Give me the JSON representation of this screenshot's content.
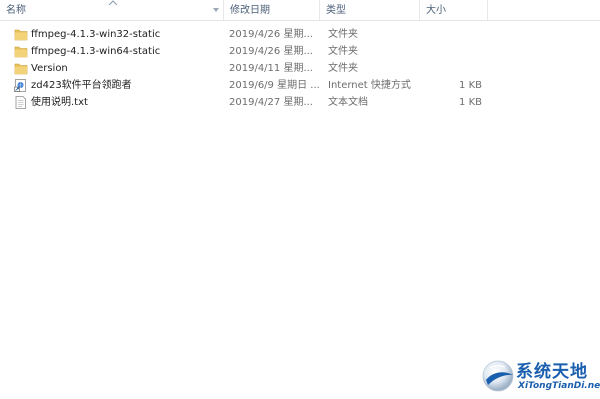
{
  "columns": {
    "name": "名称",
    "date": "修改日期",
    "type": "类型",
    "size": "大小"
  },
  "files": [
    {
      "icon": "folder-icon",
      "name": "ffmpeg-4.1.3-win32-static",
      "date": "2019/4/26 星期...",
      "type": "文件夹",
      "size": ""
    },
    {
      "icon": "folder-icon",
      "name": "ffmpeg-4.1.3-win64-static",
      "date": "2019/4/26 星期...",
      "type": "文件夹",
      "size": ""
    },
    {
      "icon": "folder-icon",
      "name": "Version",
      "date": "2019/4/11 星期...",
      "type": "文件夹",
      "size": ""
    },
    {
      "icon": "internet-shortcut-icon",
      "name": "zd423软件平台领跑者",
      "date": "2019/6/9 星期日 ...",
      "type": "Internet 快捷方式",
      "size": "1 KB"
    },
    {
      "icon": "text-file-icon",
      "name": "使用说明.txt",
      "date": "2019/4/27 星期...",
      "type": "文本文档",
      "size": "1 KB"
    }
  ],
  "watermark": {
    "title": "系统天地",
    "url": "XiTongTianDi.net"
  }
}
